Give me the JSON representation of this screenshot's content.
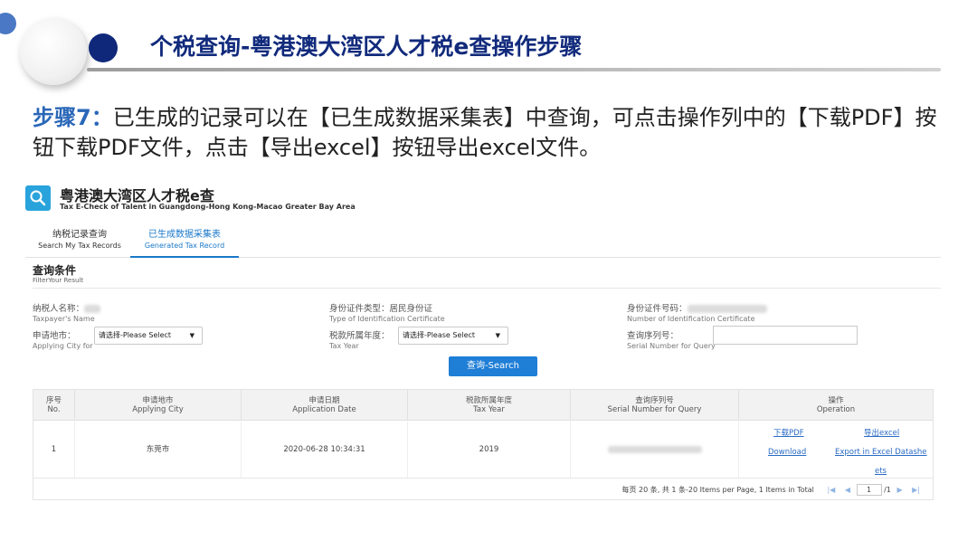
{
  "slide": {
    "title": "个税查询-粤港澳大湾区人才税e查操作步骤",
    "step_label": "步骤7：",
    "step_text": "已生成的记录可以在【已生成数据采集表】中查询，可点击操作列中的【下载PDF】按钮下载PDF文件，点击【导出excel】按钮导出excel文件。"
  },
  "app": {
    "logo_icon": "search-icon",
    "name": "粤港澳大湾区人才税e查",
    "subtitle": "Tax E-Check of Talent in Guangdong-Hong Kong-Macao Greater Bay Area",
    "tabs": [
      {
        "zh": "纳税记录查询",
        "en": "Search My Tax Records",
        "active": false
      },
      {
        "zh": "已生成数据采集表",
        "en": "Generated Tax Record",
        "active": true
      }
    ],
    "accent_color": "#1f7ed6"
  },
  "filter": {
    "title": "查询条件",
    "subtitle": "FilterYour Result",
    "taxpayer_name": {
      "zh": "纳税人名称：",
      "en": "Taxpayer's Name"
    },
    "id_type": {
      "zh": "身份证件类型：居民身份证",
      "en": "Type of Identification Certificate"
    },
    "id_number": {
      "zh": "身份证件号码：",
      "en": "Number of Identification Certificate"
    },
    "city": {
      "zh": "申请地市：",
      "en": "Applying City for",
      "value": "请选择-Please Select"
    },
    "tax_year": {
      "zh": "税款所属年度：",
      "en": "Tax Year",
      "value": "请选择-Please Select"
    },
    "serial": {
      "zh": "查询序列号：",
      "en": "Serial Number for Query",
      "value": ""
    },
    "search_button": "查询-Search"
  },
  "table": {
    "headers": [
      {
        "zh": "序号",
        "en": "No."
      },
      {
        "zh": "申请地市",
        "en": "Applying City"
      },
      {
        "zh": "申请日期",
        "en": "Application Date"
      },
      {
        "zh": "税款所属年度",
        "en": "Tax Year"
      },
      {
        "zh": "查询序列号",
        "en": "Serial Number for Query"
      },
      {
        "zh": "操作",
        "en": "Operation"
      }
    ],
    "rows": [
      {
        "no": "1",
        "city": "东莞市",
        "date": "2020-06-28 10:34:31",
        "year": "2019",
        "download_zh": "下载PDF",
        "download_en": "Download",
        "export_zh": "导出excel",
        "export_en_1": "Export in Excel Datashe",
        "export_en_2": "ets"
      }
    ],
    "pagination": {
      "summary": "每页 20 条, 共 1 条-20 Items per Page, 1 Items in Total",
      "page": "1",
      "total_pages": "/1"
    }
  }
}
